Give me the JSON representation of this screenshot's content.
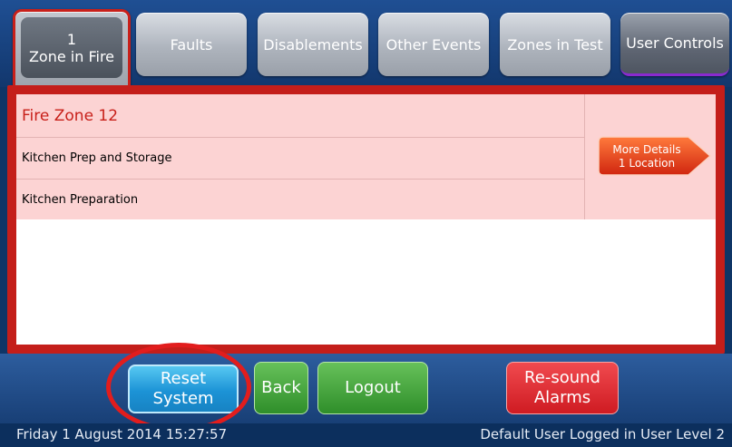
{
  "tabs": [
    {
      "line1": "1",
      "line2": "Zone in Fire"
    },
    {
      "label": "Faults"
    },
    {
      "label": "Disablements"
    },
    {
      "label": "Other Events"
    },
    {
      "label": "Zones in Test"
    },
    {
      "label": "User Controls"
    }
  ],
  "alarm": {
    "zone": "Fire Zone 12",
    "location": "Kitchen Prep and Storage",
    "description": "Kitchen Preparation",
    "more_details": {
      "line1": "More Details",
      "line2": "1 Location"
    }
  },
  "actions": {
    "reset": {
      "line1": "Reset",
      "line2": "System"
    },
    "back": "Back",
    "logout": "Logout",
    "resound": {
      "line1": "Re-sound",
      "line2": "Alarms"
    }
  },
  "status": {
    "datetime": "Friday 1 August 2014 15:27:57",
    "user": "Default User Logged in User Level 2"
  },
  "colors": {
    "alarm_red": "#c41e1a",
    "alarm_bg": "#fcd3d3",
    "reset_blue": "#1c93d6",
    "nav_green": "#2f8e2a",
    "resound_red": "#cf1b22",
    "highlight_circle": "#e21d1d"
  }
}
